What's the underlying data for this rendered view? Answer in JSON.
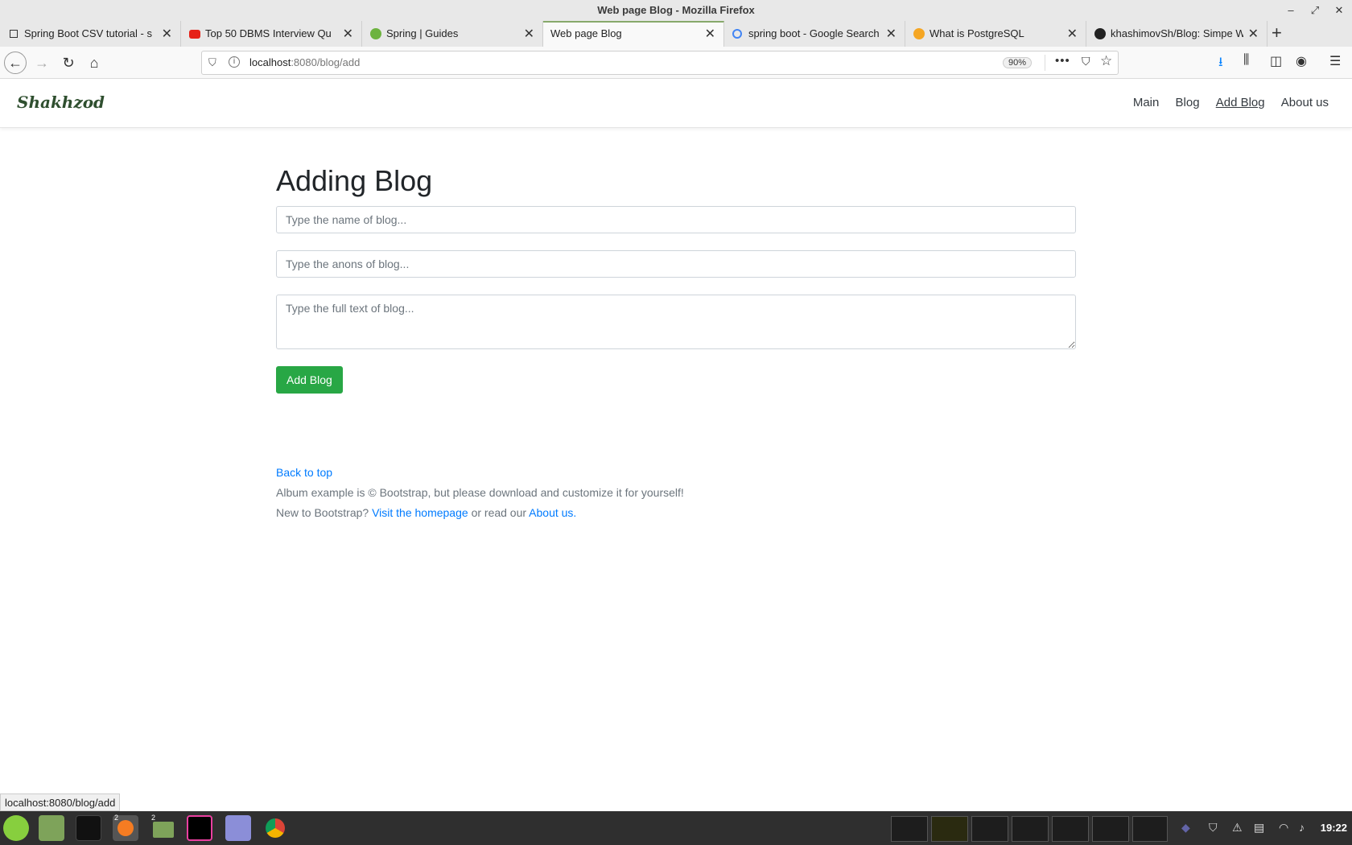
{
  "window": {
    "title": "Web page Blog - Mozilla Firefox"
  },
  "tabs": [
    {
      "label": "Spring Boot CSV tutorial - s",
      "icon": "page-icon"
    },
    {
      "label": "Top 50 DBMS Interview Qu",
      "icon": "youtube-icon"
    },
    {
      "label": "Spring | Guides",
      "icon": "spring-icon"
    },
    {
      "label": "Web page Blog",
      "icon": "none",
      "active": true
    },
    {
      "label": "spring boot - Google Search",
      "icon": "google-icon"
    },
    {
      "label": "What is PostgreSQL",
      "icon": "firefox-icon"
    },
    {
      "label": "khashimovSh/Blog: Simpe W",
      "icon": "github-icon"
    }
  ],
  "address_bar": {
    "host": "localhost",
    "path": ":8080/blog/add",
    "zoom": "90%"
  },
  "site": {
    "brand": "Shakhzod",
    "nav": [
      "Main",
      "Blog",
      "Add Blog",
      "About us"
    ],
    "active_nav": "Add Blog"
  },
  "form": {
    "heading": "Adding Blog",
    "name_placeholder": "Type the name of blog...",
    "anons_placeholder": "Type the anons of blog...",
    "fulltext_placeholder": "Type the full text of blog...",
    "submit_label": "Add Blog"
  },
  "footer": {
    "back_to_top": "Back to top",
    "line1": "Album example is © Bootstrap, but please download and customize it for yourself!",
    "line2_prefix": "New to Bootstrap?",
    "homepage_link": "Visit the homepage",
    "line2_middle": "or read our",
    "about_link": "About us."
  },
  "status_bar": "localhost:8080/blog/add",
  "taskbar": {
    "clock": "19:22",
    "firefox_badge": "2",
    "files_badge": "2"
  },
  "colors": {
    "success": "#28a745",
    "link": "#007bff",
    "brand": "#2f4f2f"
  }
}
